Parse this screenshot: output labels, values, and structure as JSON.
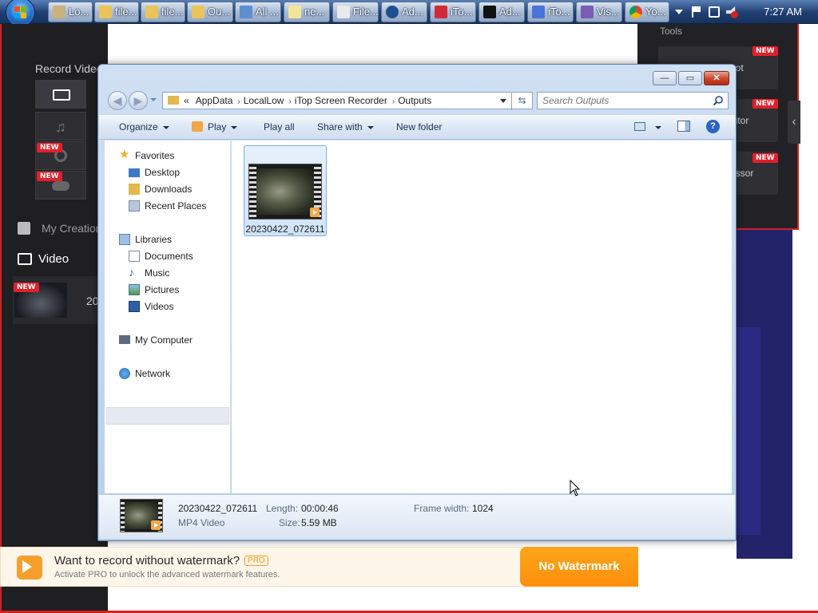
{
  "taskbar": {
    "buttons": [
      {
        "label": "Lo...",
        "icon": "app-icon"
      },
      {
        "label": "file...",
        "icon": "folder-icon"
      },
      {
        "label": "file...",
        "icon": "folder-icon"
      },
      {
        "label": "Ou...",
        "icon": "folder-icon"
      },
      {
        "label": "All ...",
        "icon": "window-icon"
      },
      {
        "label": "ne...",
        "icon": "notepad-icon"
      },
      {
        "label": "File...",
        "icon": "file-icon"
      },
      {
        "label": "Ad...",
        "icon": "app-icon"
      },
      {
        "label": "iTo...",
        "icon": "record-icon"
      },
      {
        "label": "Ad...",
        "icon": "terminal-icon"
      },
      {
        "label": "iTo...",
        "icon": "p-icon"
      },
      {
        "label": "Vis...",
        "icon": "visual-studio-icon"
      },
      {
        "label": "Yo...",
        "icon": "chrome-icon"
      }
    ],
    "clock": "7:27 AM"
  },
  "app": {
    "record_video": "Record Video",
    "my_creations": "My Creation",
    "video_tab": "Video",
    "new_badge": "NEW",
    "recording_partial": "20",
    "tools_label": "Tools",
    "tool_cards": [
      "hot",
      "ditor",
      "essor"
    ]
  },
  "explorer": {
    "breadcrumbs": [
      "AppData",
      "LocalLow",
      "iTop Screen Recorder",
      "Outputs"
    ],
    "search_placeholder": "Search Outputs",
    "commands": {
      "organize": "Organize",
      "play": "Play",
      "play_all": "Play all",
      "share_with": "Share with",
      "new_folder": "New folder"
    },
    "nav": {
      "favorites": "Favorites",
      "desktop": "Desktop",
      "downloads": "Downloads",
      "recent_places": "Recent Places",
      "libraries": "Libraries",
      "documents": "Documents",
      "music": "Music",
      "pictures": "Pictures",
      "videos": "Videos",
      "my_computer": "My Computer",
      "network": "Network"
    },
    "file": {
      "name": "20230422_072611"
    },
    "details": {
      "name": "20230422_072611",
      "type": "MP4 Video",
      "length_label": "Length:",
      "length": "00:00:46",
      "size_label": "Size:",
      "size": "5.59 MB",
      "frame_width_label": "Frame width:",
      "frame_width": "1024"
    }
  },
  "banner": {
    "title": "Want to record without watermark?",
    "pro": "PRO",
    "subtitle": "Activate PRO to unlock the advanced watermark features.",
    "button": "No Watermark"
  },
  "colors": {
    "accent_orange": "#ff9a14",
    "new_badge_red": "#e2202a",
    "taskbar_blue": "#1f3e72"
  }
}
